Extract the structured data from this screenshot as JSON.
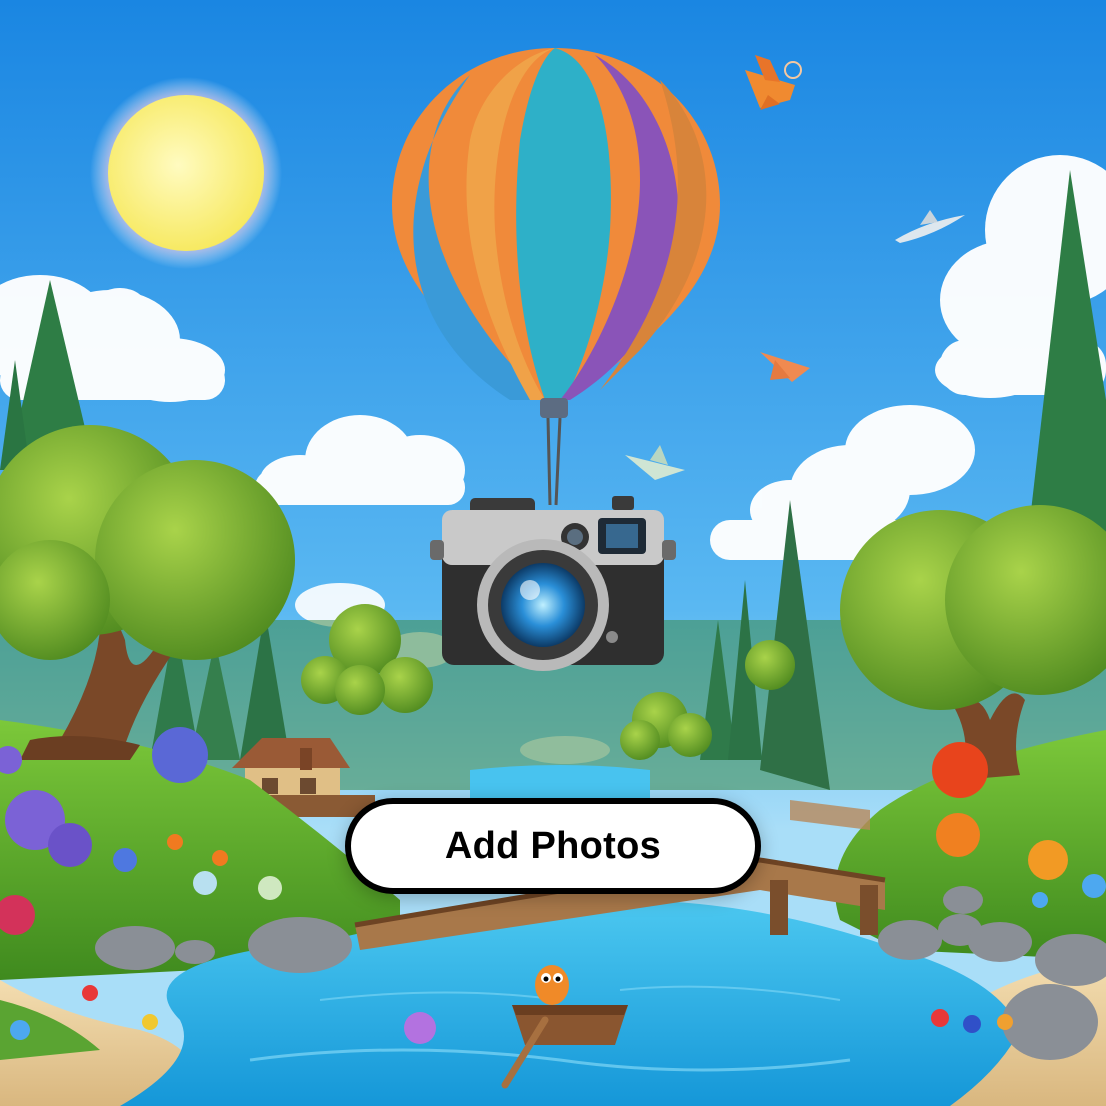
{
  "cta": {
    "label": "Add Photos"
  },
  "illustration": {
    "icon": "camera-balloon-illustration"
  },
  "colors": {
    "sky_top": "#1a8ce6",
    "sky_bottom": "#a8dcf7",
    "water": "#27b7ea",
    "grass": "#5cae2e",
    "button_bg": "#ffffff",
    "button_border": "#000000",
    "button_text": "#000000"
  }
}
